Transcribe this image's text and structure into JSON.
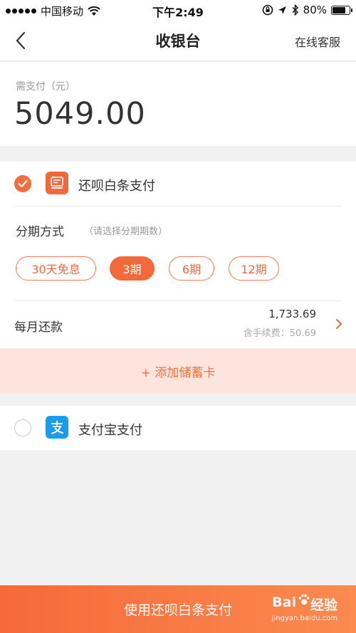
{
  "status_bar": {
    "carrier": "中国移动",
    "time": "下午2:49",
    "battery": "80%",
    "battery_level": 0.8
  },
  "nav": {
    "title": "收银台",
    "service": "在线客服"
  },
  "amount": {
    "label": "需支付（元）",
    "value": "5049.00"
  },
  "baitiao": {
    "label": "还呗白条支付",
    "selected": true,
    "installment_title": "分期方式",
    "installment_hint": "（请选择分期期数）",
    "periods": [
      "30天免息",
      "3期",
      "6期",
      "12期"
    ],
    "active_period": "3期",
    "monthly_label": "每月还款",
    "monthly_amount": "1,733.69",
    "monthly_fee": "含手续费：50.69",
    "add_card": "+ 添加储蓄卡"
  },
  "alipay": {
    "label": "支付宝支付",
    "selected": false
  },
  "pay_button": "使用还呗白条支付",
  "watermark": {
    "main": "Bai",
    "main2": "经验",
    "sub": "jingyan.baidu.com"
  },
  "colors": {
    "accent": "#f26a3c",
    "alipay": "#1a9ce8",
    "add_card_bg": "#fde4dc"
  }
}
